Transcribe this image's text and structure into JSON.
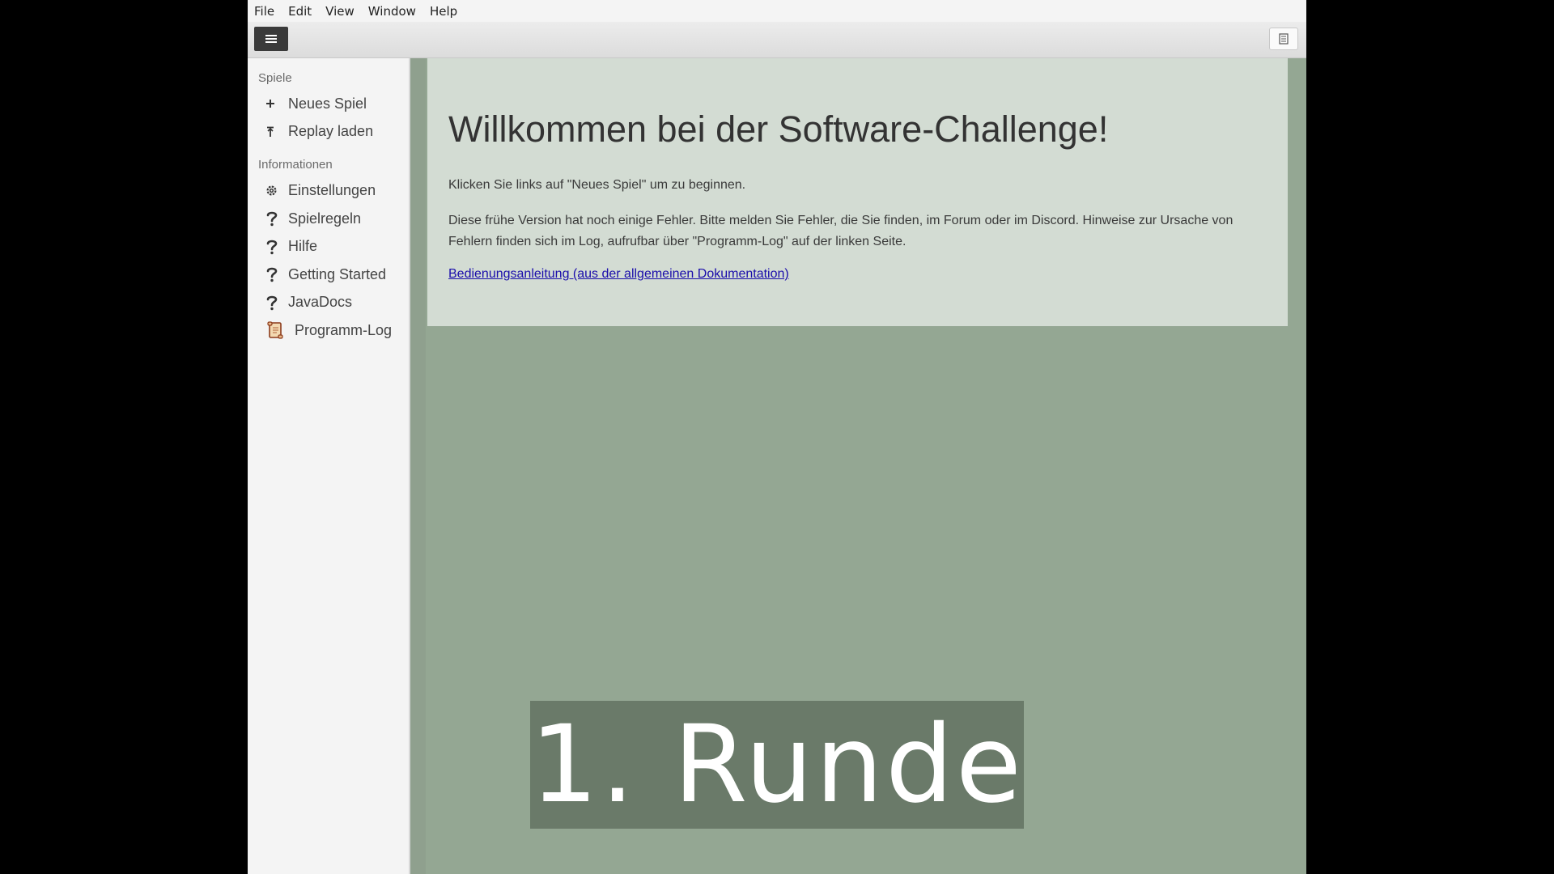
{
  "menu": {
    "file": "File",
    "edit": "Edit",
    "view": "View",
    "window": "Window",
    "help": "Help"
  },
  "toolbar": {
    "menu_icon": "hamburger-menu-icon",
    "log_icon": "document-icon"
  },
  "sidebar": {
    "section_games": "Spiele",
    "section_info": "Informationen",
    "items": [
      {
        "label": "Neues Spiel",
        "icon": "plus-icon"
      },
      {
        "label": "Replay laden",
        "icon": "upload-icon"
      },
      {
        "label": "Einstellungen",
        "icon": "gear-icon"
      },
      {
        "label": "Spielregeln",
        "icon": "question-icon"
      },
      {
        "label": "Hilfe",
        "icon": "question-icon"
      },
      {
        "label": "Getting Started",
        "icon": "question-icon"
      },
      {
        "label": "JavaDocs",
        "icon": "question-icon"
      },
      {
        "label": "Programm-Log",
        "icon": "scroll-icon"
      }
    ]
  },
  "welcome": {
    "title": "Willkommen bei der Software-Challenge!",
    "line1": "Klicken Sie links auf \"Neues Spiel\" um zu beginnen.",
    "line2": "Diese frühe Version hat noch einige Fehler. Bitte melden Sie Fehler, die Sie finden, im Forum oder im Discord. Hinweise zur Ursache von Fehlern finden sich im Log, aufrufbar über \"Programm-Log\" auf der linken Seite.",
    "link": "Bedienungsanleitung (aus der allgemeinen Dokumentation)"
  },
  "overlay": {
    "round_text": "1. Runde"
  },
  "colors": {
    "background_area": "#94a793",
    "panel": "#d3dcd3",
    "link": "#1a0dab",
    "overlay": "#6a7a69"
  }
}
